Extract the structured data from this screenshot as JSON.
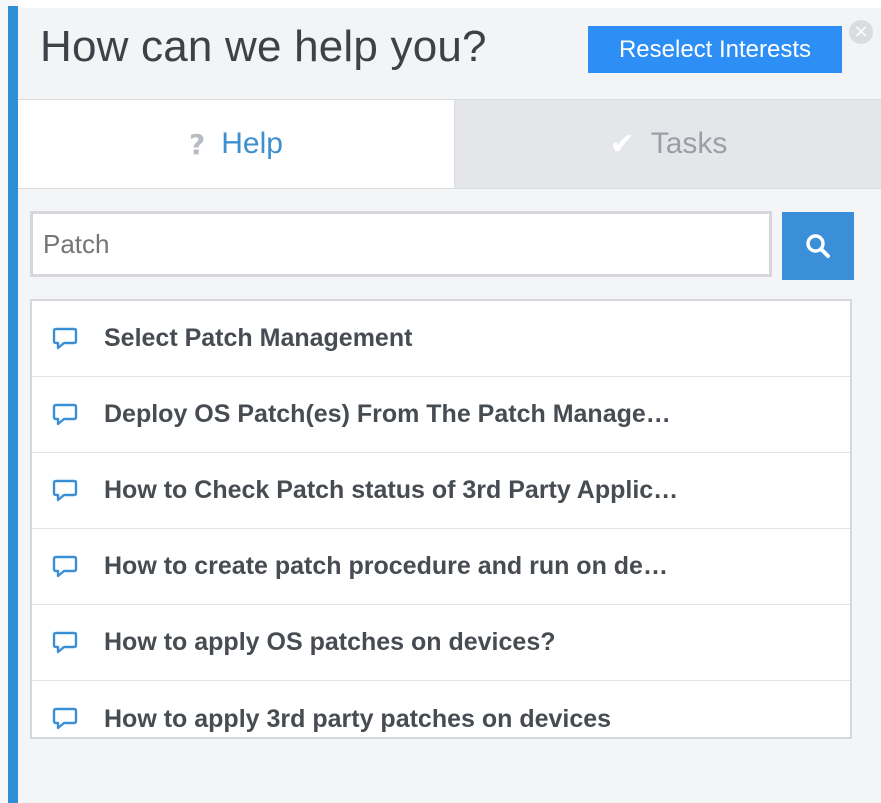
{
  "header": {
    "title": "How can we help you?",
    "reselect_label": "Reselect Interests",
    "close_symbol": "×"
  },
  "tabs": [
    {
      "label": "Help",
      "icon": "question-icon",
      "glyph": "?",
      "active": true
    },
    {
      "label": "Tasks",
      "icon": "checkmark-icon",
      "glyph": "✔",
      "active": false
    }
  ],
  "search": {
    "value": "",
    "placeholder": "Patch",
    "icon": "search-icon"
  },
  "results": [
    {
      "label": "Select Patch Management",
      "icon": "chat-bubble-icon"
    },
    {
      "label": "Deploy OS Patch(es) From The Patch Manage…",
      "icon": "chat-bubble-icon"
    },
    {
      "label": "How to Check Patch status of 3rd Party Applic…",
      "icon": "chat-bubble-icon"
    },
    {
      "label": "How to create patch procedure and run on de…",
      "icon": "chat-bubble-icon"
    },
    {
      "label": "How to apply OS patches on devices?",
      "icon": "chat-bubble-icon"
    },
    {
      "label": "How to apply 3rd party patches on devices",
      "icon": "chat-bubble-icon"
    }
  ],
  "colors": {
    "accent": "#2f8fd6",
    "button_blue": "#2d8ff5",
    "search_blue": "#3a8fd8",
    "active_tab_text": "#3d8fd0"
  }
}
